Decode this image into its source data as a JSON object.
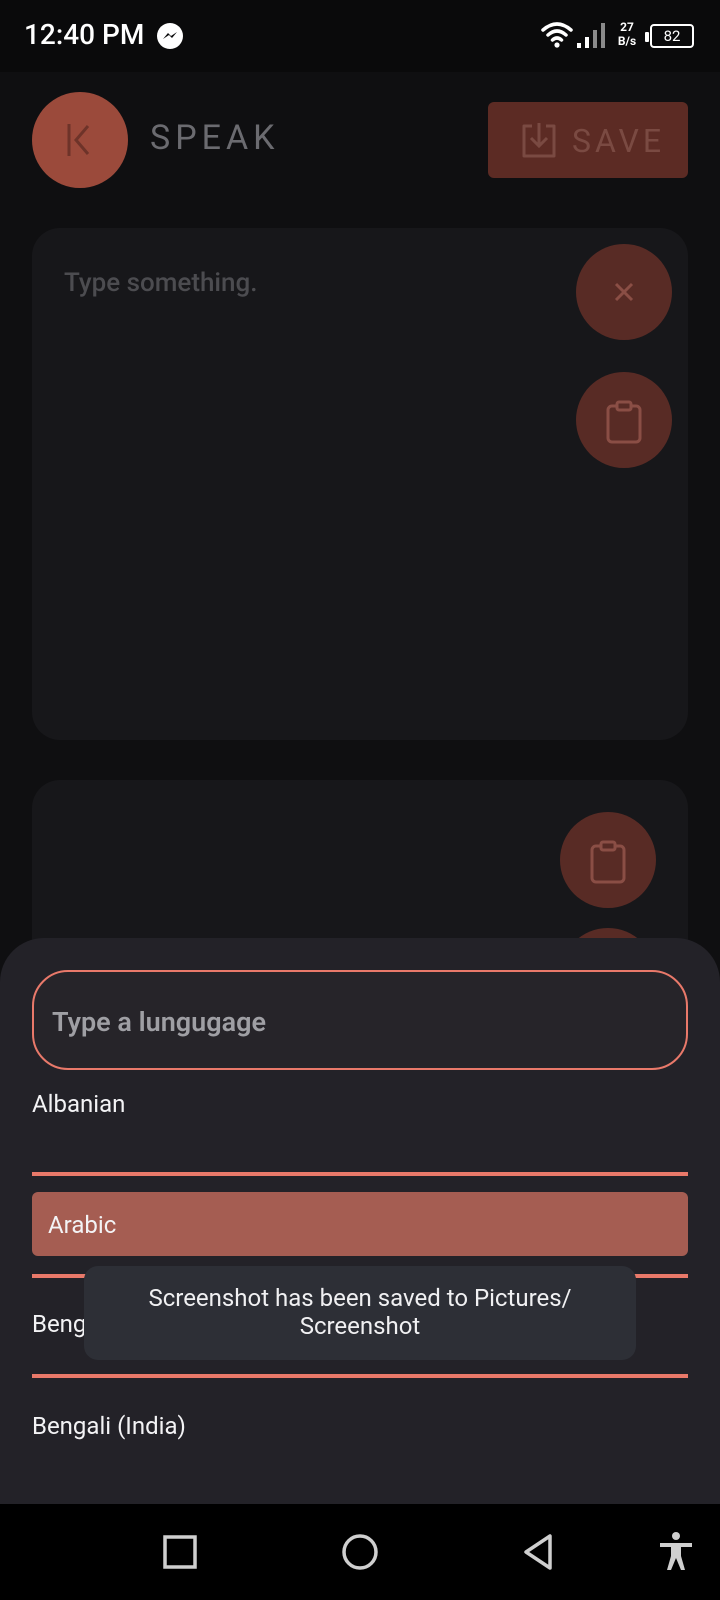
{
  "status_bar": {
    "time": "12:40 PM",
    "net_speed_value": "27",
    "net_speed_unit": "B/s",
    "battery": "82",
    "icons": [
      "messenger-icon",
      "wifi-icon",
      "signal-icon"
    ]
  },
  "header": {
    "title": "SPEAK",
    "save_label": "SAVE",
    "icons": [
      "back-to-start-icon",
      "download-icon"
    ]
  },
  "input_card": {
    "placeholder": "Type something.",
    "icons": [
      "close-icon",
      "clipboard-icon"
    ]
  },
  "output_card": {
    "icons": [
      "clipboard-icon"
    ]
  },
  "language_sheet": {
    "search_placeholder": "Type a lungugage",
    "languages": [
      {
        "label": "Albanian",
        "selected": false
      },
      {
        "label": "Arabic",
        "selected": true
      },
      {
        "label": "Bengali (Bangladesh)",
        "selected": false
      },
      {
        "label": "Bengali (India)",
        "selected": false
      }
    ]
  },
  "toast": {
    "line1": "Screenshot has been saved to  Pictures/",
    "line2": "Screenshot"
  },
  "nav_bar": {
    "icons": [
      "recents-icon",
      "home-icon",
      "back-icon",
      "accessibility-icon"
    ]
  },
  "colors": {
    "accent": "#e9796a",
    "selected_row": "#a55d52",
    "sheet_bg": "#232228",
    "card_bg": "#17171a"
  }
}
